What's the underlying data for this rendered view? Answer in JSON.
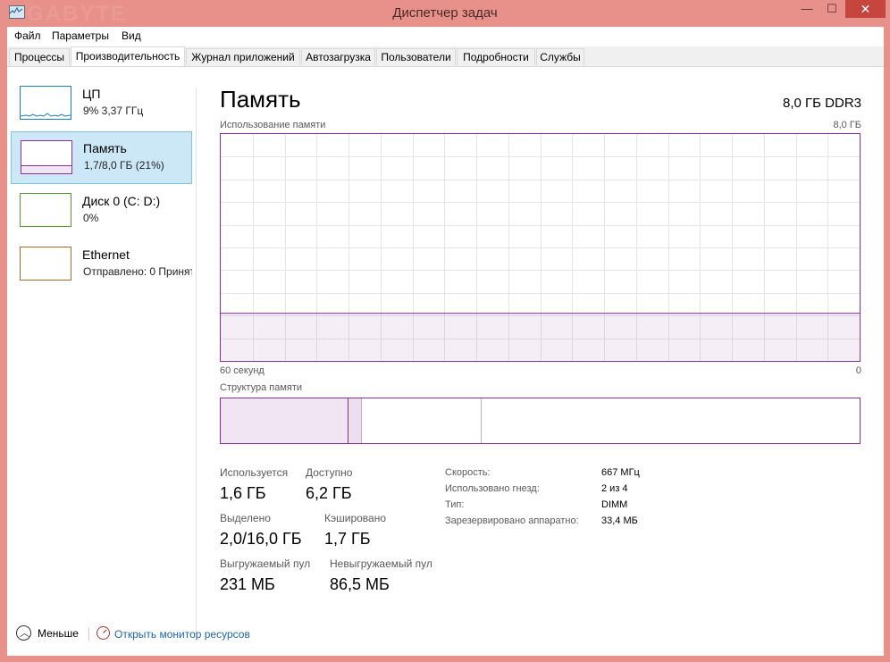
{
  "window": {
    "title": "Диспетчер задач",
    "background_brand": "GABYTE",
    "controls": {
      "minimize": "—",
      "maximize": "☐",
      "close": "✕"
    }
  },
  "menu": [
    "Файл",
    "Параметры",
    "Вид"
  ],
  "tabs": [
    {
      "label": "Процессы",
      "active": false
    },
    {
      "label": "Производительность",
      "active": true
    },
    {
      "label": "Журнал приложений",
      "active": false
    },
    {
      "label": "Автозагрузка",
      "active": false
    },
    {
      "label": "Пользователи",
      "active": false
    },
    {
      "label": "Подробности",
      "active": false
    },
    {
      "label": "Службы",
      "active": false
    }
  ],
  "sidebar": {
    "items": [
      {
        "name": "ЦП",
        "sub": "9% 3,37 ГГц",
        "color": "#1b7fbf",
        "selected": false
      },
      {
        "name": "Память",
        "sub": "1,7/8,0 ГБ (21%)",
        "color": "#8b2c9f",
        "selected": true
      },
      {
        "name": "Диск 0 (C: D:)",
        "sub": "0%",
        "color": "#4e9a2a",
        "selected": false
      },
      {
        "name": "Ethernet",
        "sub": "Отправлено: 0 Принят",
        "color": "#a76a2c",
        "selected": false
      }
    ]
  },
  "memory": {
    "title": "Память",
    "spec": "8,0 ГБ DDR3",
    "graph_label": "Использование памяти",
    "graph_max": "8,0 ГБ",
    "graph_time_left": "60 секунд",
    "graph_time_right": "0",
    "structure_label": "Структура памяти",
    "usage_fraction": 0.21,
    "stats": {
      "in_use_label": "Используется",
      "in_use_value": "1,6 ГБ",
      "available_label": "Доступно",
      "available_value": "6,2 ГБ",
      "committed_label": "Выделено",
      "committed_value": "2,0/16,0 ГБ",
      "cached_label": "Кэшировано",
      "cached_value": "1,7 ГБ",
      "paged_label": "Выгружаемый пул",
      "paged_value": "231 МБ",
      "nonpaged_label": "Невыгружаемый пул",
      "nonpaged_value": "86,5 МБ"
    },
    "info": {
      "speed_label": "Скорость:",
      "speed_value": "667 МГц",
      "slots_label": "Использовано гнезд:",
      "slots_value": "2 из 4",
      "type_label": "Тип:",
      "type_value": "DIMM",
      "reserved_label": "Зарезервировано аппаратно:",
      "reserved_value": "33,4 МБ"
    }
  },
  "footer": {
    "less_label": "Меньше",
    "resmon_link": "Открыть монитор ресурсов"
  },
  "colors": {
    "accent_memory": "#8b2c9f",
    "selection": "#cce8f7",
    "link": "#1d63b4"
  }
}
